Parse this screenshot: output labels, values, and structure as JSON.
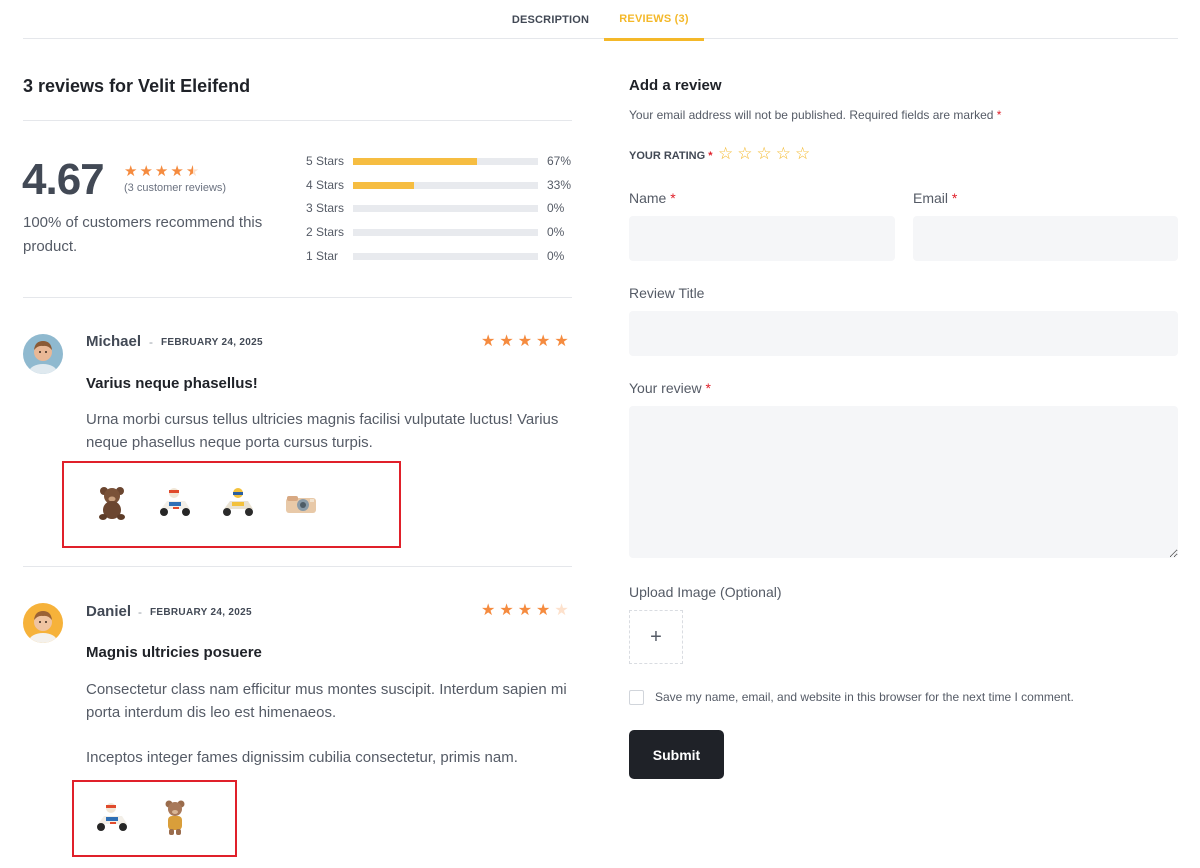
{
  "tabs": {
    "description": "DESCRIPTION",
    "reviews": "REVIEWS (3)"
  },
  "summary": {
    "title": "3 reviews for Velit Eleifend",
    "average": "4.67",
    "average_value": 4.67,
    "customer_reviews": "(3 customer reviews)",
    "recommend": "100% of customers recommend this product.",
    "breakdown": [
      {
        "label": "5 Stars",
        "pct": "67%",
        "fraction": 0.67
      },
      {
        "label": "4 Stars",
        "pct": "33%",
        "fraction": 0.33
      },
      {
        "label": "3 Stars",
        "pct": "0%",
        "fraction": 0
      },
      {
        "label": "2 Stars",
        "pct": "0%",
        "fraction": 0
      },
      {
        "label": "1 Star",
        "pct": "0%",
        "fraction": 0
      }
    ]
  },
  "reviews": [
    {
      "author": "Michael",
      "date": "FEBRUARY 24, 2025",
      "rating": 5,
      "title": "Varius neque phasellus!",
      "text": "Urna morbi cursus tellus ultricies magnis facilisi vulputate luctus! Varius neque phasellus neque porta cursus turpis.",
      "images": [
        "teddy-bear",
        "race-car-toy",
        "race-car-toy-yellow",
        "toy-camera"
      ]
    },
    {
      "author": "Daniel",
      "date": "FEBRUARY 24, 2025",
      "rating": 4,
      "title": "Magnis ultricies posuere",
      "text": "Consectetur class nam efficitur mus montes suscipit. Interdum sapien mi porta interdum dis leo est himenaeos.",
      "text2": "Inceptos integer fames dignissim cubilia consectetur, primis nam.",
      "images": [
        "race-car-toy",
        "teddy-bear-overalls"
      ]
    }
  ],
  "form": {
    "title": "Add a review",
    "notice": "Your email address will not be published. Required fields are marked",
    "required_mark": "*",
    "rating_label": "YOUR RATING",
    "name_label": "Name",
    "email_label": "Email",
    "review_title_label": "Review Title",
    "review_label": "Your review",
    "upload_label": "Upload Image (Optional)",
    "upload_glyph": "+",
    "save_label": "Save my name, email, and website in this browser for the next time I comment.",
    "submit_label": "Submit"
  },
  "colors": {
    "accent": "#f4b829",
    "star": "#f58b3f",
    "highlight": "#e0202a",
    "button": "#1f2228"
  }
}
